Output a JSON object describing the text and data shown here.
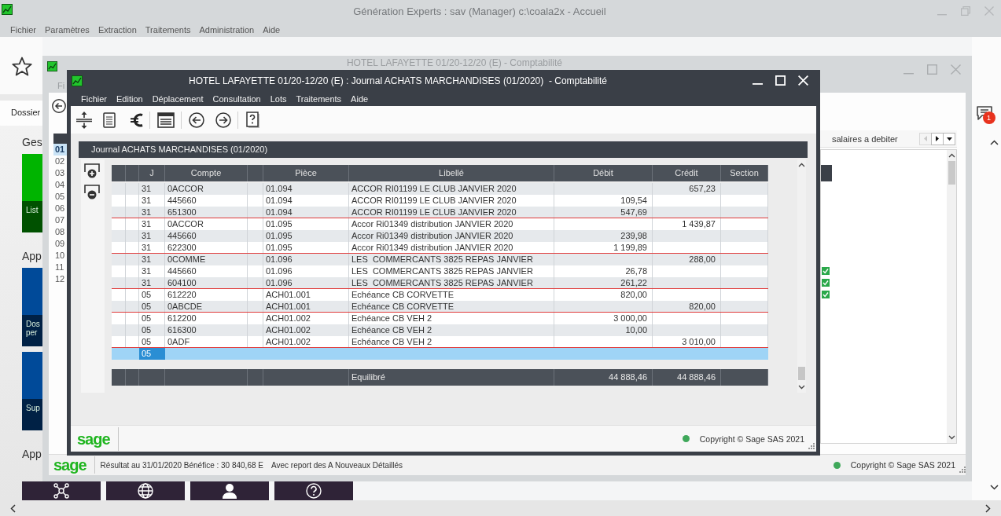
{
  "app_window": {
    "title": "Génération Experts : sav (Manager) c:\\coala2x - Accueil",
    "menu": [
      "Fichier",
      "Paramètres",
      "Extraction",
      "Traitements",
      "Administration",
      "Aide"
    ],
    "tab": "Dossier",
    "sections": [
      {
        "heading": "Ges",
        "tiles": [
          {
            "kind": "caption",
            "label": "List",
            "color": "#00b400"
          }
        ]
      },
      {
        "heading": "App",
        "tiles": [
          {
            "kind": "caption",
            "label": "Dos per",
            "color": "#004a99"
          },
          {
            "kind": "caption",
            "label": "Sup",
            "color": "#004a99"
          }
        ]
      },
      {
        "heading": "App",
        "tiles": [
          {
            "kind": "network",
            "color": "#2f2337"
          },
          {
            "kind": "globe",
            "color": "#2f2337"
          },
          {
            "kind": "person",
            "color": "#2f2337"
          },
          {
            "kind": "help",
            "color": "#2f2337"
          }
        ]
      }
    ],
    "notification_count": "1"
  },
  "accounting_window": {
    "title": "HOTEL LAFAYETTE 01/20-12/20 (E) - Comptabilité",
    "menu": [
      "Fi"
    ],
    "periods": [
      {
        "label": "01",
        "selected": true
      },
      {
        "label": "02",
        "selected": false
      },
      {
        "label": "03",
        "selected": false
      },
      {
        "label": "04",
        "selected": false
      },
      {
        "label": "05",
        "selected": false
      },
      {
        "label": "06",
        "selected": false
      },
      {
        "label": "07",
        "selected": false
      },
      {
        "label": "08",
        "selected": false
      },
      {
        "label": "09",
        "selected": false
      },
      {
        "label": "10",
        "selected": false
      },
      {
        "label": "11",
        "selected": false
      },
      {
        "label": "12",
        "selected": false
      }
    ],
    "tab": {
      "label": "salaires a debiter",
      "nav_buttons": [
        {
          "kind": "previous",
          "disabled": true
        },
        {
          "kind": "next",
          "disabled": false
        },
        {
          "kind": "dropdown",
          "disabled": false
        }
      ]
    },
    "status_bar": {
      "logo": "sage",
      "result": "Résultat au 31/01/2020 Bénéfice : 30 840,68 E",
      "report": "Avec report des A Nouveaux Détaillés",
      "copyright": "Copyright © Sage SAS 2021"
    }
  },
  "journal_window": {
    "title": "HOTEL LAFAYETTE 01/20-12/20 (E) : Journal ACHATS MARCHANDISES (01/2020)  - Comptabilité",
    "menu": [
      "Fichier",
      "Edition",
      "Déplacement",
      "Consultation",
      "Lots",
      "Traitements",
      "Aide"
    ],
    "panel_title": "Journal ACHATS MARCHANDISES (01/2020)",
    "table": {
      "columns": [
        {
          "kind": "blank"
        },
        {
          "kind": "blank"
        },
        {
          "kind": "text",
          "label": "J"
        },
        {
          "kind": "text",
          "label": "Compte"
        },
        {
          "kind": "blank"
        },
        {
          "kind": "text",
          "label": "Pièce"
        },
        {
          "kind": "text",
          "label": "Libellé"
        },
        {
          "kind": "amount",
          "label": "Débit"
        },
        {
          "kind": "amount",
          "label": "Crédit"
        },
        {
          "kind": "text",
          "label": "Section"
        }
      ],
      "groups": [
        {
          "rows": [
            {
              "j": "31",
              "compte": "0ACCOR",
              "piece": "01.094",
              "libelle": "ACCOR RI01199 LE CLUB JANVIER 2020",
              "credit": "657,23",
              "selected": false
            },
            {
              "j": "31",
              "compte": "445660",
              "piece": "01.094",
              "libelle": "ACCOR RI01199 LE CLUB JANVIER 2020",
              "debit": "109,54",
              "selected": false
            },
            {
              "j": "31",
              "compte": "651300",
              "piece": "01.094",
              "libelle": "ACCOR RI01199 LE CLUB JANVIER 2020",
              "debit": "547,69",
              "selected": false
            }
          ]
        },
        {
          "rows": [
            {
              "j": "31",
              "compte": "0ACCOR",
              "piece": "01.095",
              "libelle": "Accor Ri01349 distribution JANVIER 2020",
              "credit": "1 439,87",
              "selected": false
            },
            {
              "j": "31",
              "compte": "445660",
              "piece": "01.095",
              "libelle": "Accor Ri01349 distribution JANVIER 2020",
              "debit": "239,98",
              "selected": false
            },
            {
              "j": "31",
              "compte": "622300",
              "piece": "01.095",
              "libelle": "Accor Ri01349 distribution JANVIER 2020",
              "debit": "1 199,89",
              "selected": false
            }
          ]
        },
        {
          "rows": [
            {
              "j": "31",
              "compte": "0COMME",
              "piece": "01.096",
              "libelle": "LES  COMMERCANTS 3825 REPAS JANVIER",
              "credit": "288,00",
              "selected": false
            },
            {
              "j": "31",
              "compte": "445660",
              "piece": "01.096",
              "libelle": "LES  COMMERCANTS 3825 REPAS JANVIER",
              "debit": "26,78",
              "selected": false
            },
            {
              "j": "31",
              "compte": "604100",
              "piece": "01.096",
              "libelle": "LES  COMMERCANTS 3825 REPAS JANVIER",
              "debit": "261,22",
              "selected": false
            }
          ]
        },
        {
          "rows": [
            {
              "j": "05",
              "compte": "612220",
              "piece": "ACH01.001",
              "libelle": "Echéance CB CORVETTE",
              "debit": "820,00",
              "selected": false
            },
            {
              "j": "05",
              "compte": "0ABCDE",
              "piece": "ACH01.001",
              "libelle": "Echéance CB CORVETTE",
              "credit": "820,00",
              "selected": false
            }
          ]
        },
        {
          "rows": [
            {
              "j": "05",
              "compte": "612200",
              "piece": "ACH01.002",
              "libelle": "Echéance CB VEH 2",
              "debit": "3 000,00",
              "selected": false
            },
            {
              "j": "05",
              "compte": "616300",
              "piece": "ACH01.002",
              "libelle": "Echéance CB VEH 2",
              "debit": "10,00",
              "selected": false
            },
            {
              "j": "05",
              "compte": "0ADF",
              "piece": "ACH01.002",
              "libelle": "Echéance CB VEH 2",
              "credit": "3 010,00",
              "selected": false
            }
          ]
        }
      ],
      "entry_row": {
        "j": "05",
        "selected": true
      },
      "totals": {
        "libelle": "Equilibré",
        "debit": "44 888,46",
        "credit": "44 888,46"
      }
    },
    "footer": {
      "logo": "sage",
      "copyright": "Copyright © Sage SAS 2021"
    }
  }
}
